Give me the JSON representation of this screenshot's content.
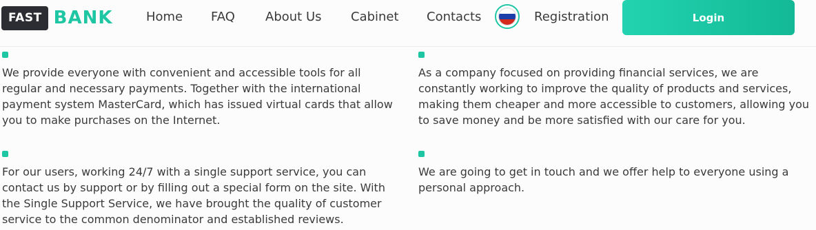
{
  "logo": {
    "part1": "FAST",
    "part2": "BANK"
  },
  "nav": {
    "home": "Home",
    "faq": "FAQ",
    "about": "About Us",
    "cabinet": "Cabinet",
    "contacts": "Contacts",
    "registration": "Registration"
  },
  "language": {
    "icon": "russia-flag-icon",
    "colors": [
      "#ffffff",
      "#1c3ea8",
      "#d52b1e"
    ]
  },
  "login": {
    "label": "Login"
  },
  "colors": {
    "accent": "#1ec6a3",
    "logo_dark": "#2b2d33",
    "text": "#3a3a3a"
  },
  "features": [
    {
      "text": "We provide everyone with convenient and accessible tools for all regular and necessary payments. Together with the international payment system MasterCard, which has issued virtual cards that allow you to make purchases on the Internet."
    },
    {
      "text": "As a company focused on providing financial services, we are constantly working to improve the quality of products and services, making them cheaper and more accessible to customers, allowing you to save money and be more satisfied with our care for you."
    },
    {
      "text": "For our users, working 24/7 with a single support service, you can contact us by support or by filling out a special form on the site. With the Single Support Service, we have brought the quality of customer service to the common denominator and established reviews."
    },
    {
      "text": "We are going to get in touch and we offer help to everyone using a personal approach."
    }
  ]
}
